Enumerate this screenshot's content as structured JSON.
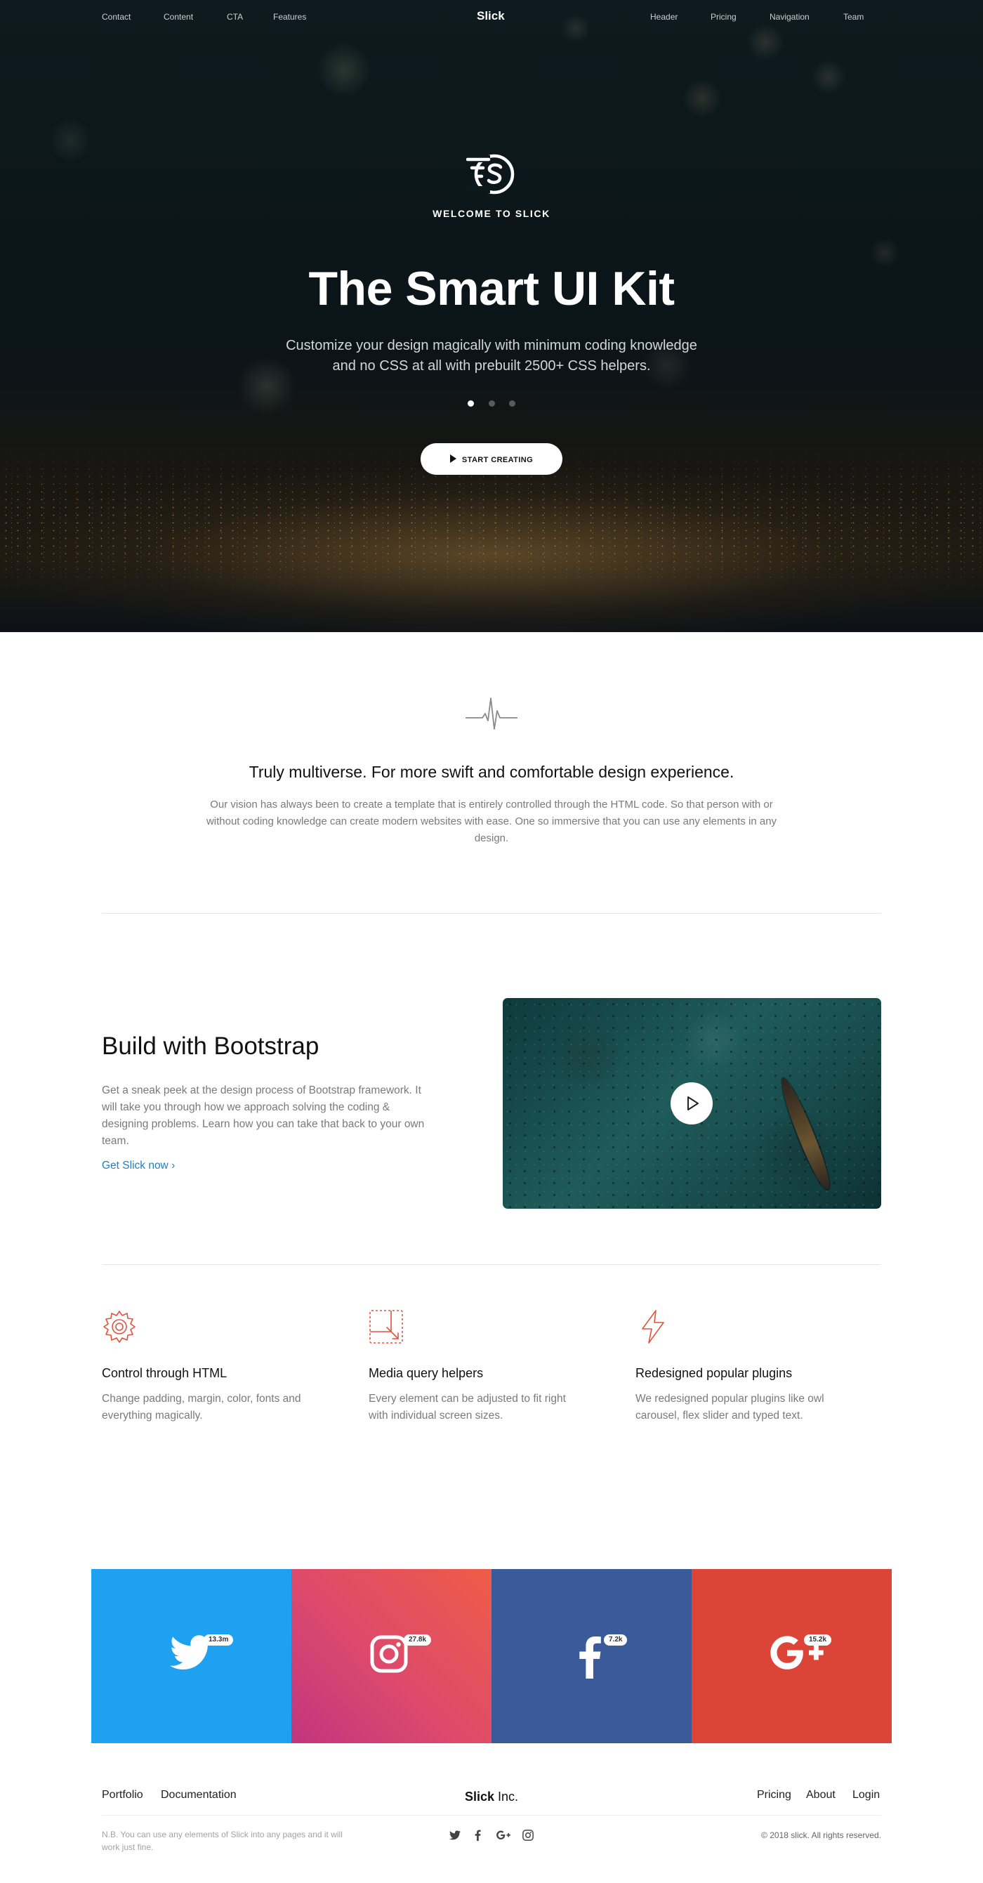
{
  "nav": {
    "left": [
      "Contact",
      "Content",
      "CTA",
      "Features"
    ],
    "brand": "Slick",
    "right": [
      "Header",
      "Pricing",
      "Navigation",
      "Team"
    ]
  },
  "hero": {
    "logo_icon": "slick-s-logo-icon",
    "welcome": "WELCOME TO SLICK",
    "title": "The Smart UI Kit",
    "subtitle_line1": "Customize your design magically with minimum coding knowledge",
    "subtitle_line2": "and no CSS at all with prebuilt 2500+ CSS helpers.",
    "carousel_active_index": 0,
    "carousel_count": 3,
    "cta_label": "START CREATING"
  },
  "intro": {
    "icon": "pulse-icon",
    "heading": "Truly multiverse. For more swift and comfortable design experience.",
    "body": "Our vision has always been to create a template that is entirely controlled through the HTML code. So that person with or without coding knowledge can create modern websites with ease. One so immersive that you can use any elements in any design."
  },
  "build": {
    "heading": "Build with Bootstrap",
    "body": "Get a sneak peek at the design process of Bootstrap framework. It will take you through how we approach solving the coding & designing problems. Learn how you can take that back to your own team.",
    "link": "Get Slick now",
    "video_icon": "play-icon"
  },
  "features": [
    {
      "icon": "gear-icon",
      "title": "Control through HTML",
      "text": "Change padding, margin, color, fonts and everything magically."
    },
    {
      "icon": "resize-icon",
      "title": "Media query helpers",
      "text": "Every element can be adjusted to fit right with individual screen sizes."
    },
    {
      "icon": "lightning-icon",
      "title": "Redesigned popular plugins",
      "text": "We redesigned popular plugins like owl carousel, flex slider and typed text."
    }
  ],
  "social": [
    {
      "network": "twitter",
      "icon": "twitter-icon",
      "count": "13.3m",
      "color": "#1ea1f1"
    },
    {
      "network": "instagram",
      "icon": "instagram-icon",
      "count": "27.8k",
      "color": "#dd4a6c"
    },
    {
      "network": "facebook",
      "icon": "facebook-icon",
      "count": "7.2k",
      "color": "#3b5a9a"
    },
    {
      "network": "google-plus",
      "icon": "google-plus-icon",
      "count": "15.2k",
      "color": "#dc4437"
    }
  ],
  "footer": {
    "left_links": [
      "Portfolio",
      "Documentation"
    ],
    "brand_bold": "Slick",
    "brand_rest": " Inc.",
    "right_links": [
      "Pricing",
      "About",
      "Login"
    ],
    "note": "N.B. You can use any elements of Slick into any pages and it will work just fine.",
    "social_icons": [
      "twitter-icon",
      "facebook-icon",
      "google-plus-icon",
      "instagram-icon"
    ],
    "copyright": "© 2018 slick. All rights reserved."
  },
  "colors": {
    "accent_link": "#1f7fc4",
    "feature_icon": "#e0533d",
    "muted_text": "#7a7a7a"
  }
}
